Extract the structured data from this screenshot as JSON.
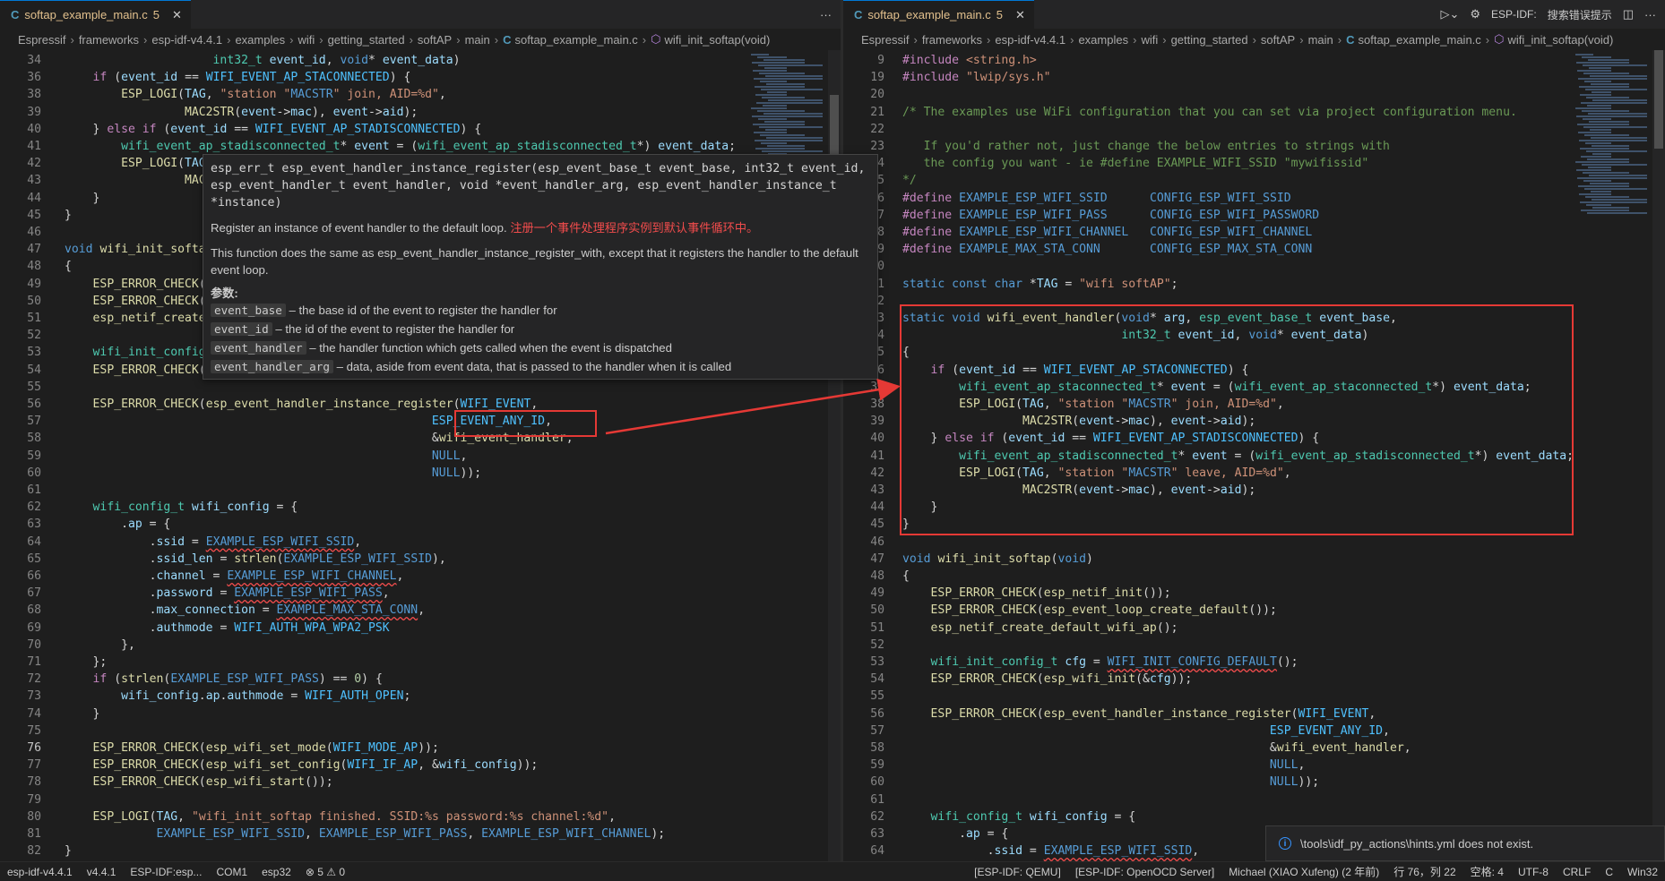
{
  "left_editor": {
    "tab": {
      "label": "softap_example_main.c",
      "problems": "5"
    },
    "more_label": "···",
    "breadcrumb": [
      "Espressif",
      "frameworks",
      "esp-idf-v4.4.1",
      "examples",
      "wifi",
      "getting_started",
      "softAP",
      "main",
      "softap_example_main.c",
      "wifi_init_softap(void)"
    ],
    "sticky_line": {
      "num": "34",
      "text": "int32_t event_id, void* event_data)"
    }
  },
  "right_editor": {
    "tab": {
      "label": "softap_example_main.c",
      "problems": "5"
    },
    "esp_idf_label": "ESP-IDF:",
    "search_error_label": "搜索错误提示",
    "breadcrumb": [
      "Espressif",
      "frameworks",
      "esp-idf-v4.4.1",
      "examples",
      "wifi",
      "getting_started",
      "softAP",
      "main",
      "softap_example_main.c",
      "wifi_init_softap(void)"
    ]
  },
  "hover": {
    "signature_line1": "esp_err_t esp_event_handler_instance_register(esp_event_base_t event_base, int32_t event_id,",
    "signature_line2": "esp_event_handler_t event_handler, void *event_handler_arg, esp_event_handler_instance_t",
    "signature_line3": "*instance)",
    "summary": "Register an instance of event handler to the default loop.",
    "summary_zh": "注册一个事件处理程序实例到默认事件循环中。",
    "detail": "This function does the same as esp_event_handler_instance_register_with, except that it registers the handler to the default event loop.",
    "params_label": "参数:",
    "params": [
      {
        "name": "event_base",
        "desc": "– the base id of the event to register the handler for"
      },
      {
        "name": "event_id",
        "desc": "– the id of the event to register the handler for"
      },
      {
        "name": "event_handler",
        "desc": "– the handler function which gets called when the event is dispatched"
      },
      {
        "name": "event_handler_arg",
        "desc": "– data, aside from event data, that is passed to the handler when it is called"
      }
    ]
  },
  "notification": {
    "text": "\\tools\\idf_py_actions\\hints.yml does not exist."
  },
  "statusbar": {
    "items": [
      "esp-idf-v4.4.1",
      "v4.4.1",
      "ESP-IDF:esp...",
      "COM1",
      "esp32",
      "5",
      "0",
      "[ESP-IDF: QEMU]",
      "[ESP-IDF: OpenOCD Server]",
      "Michael (XIAO Xufeng) (2 年前)",
      "行 76，列 22",
      "空格: 4",
      "UTF-8",
      "CRLF",
      "C",
      "Win32"
    ]
  }
}
